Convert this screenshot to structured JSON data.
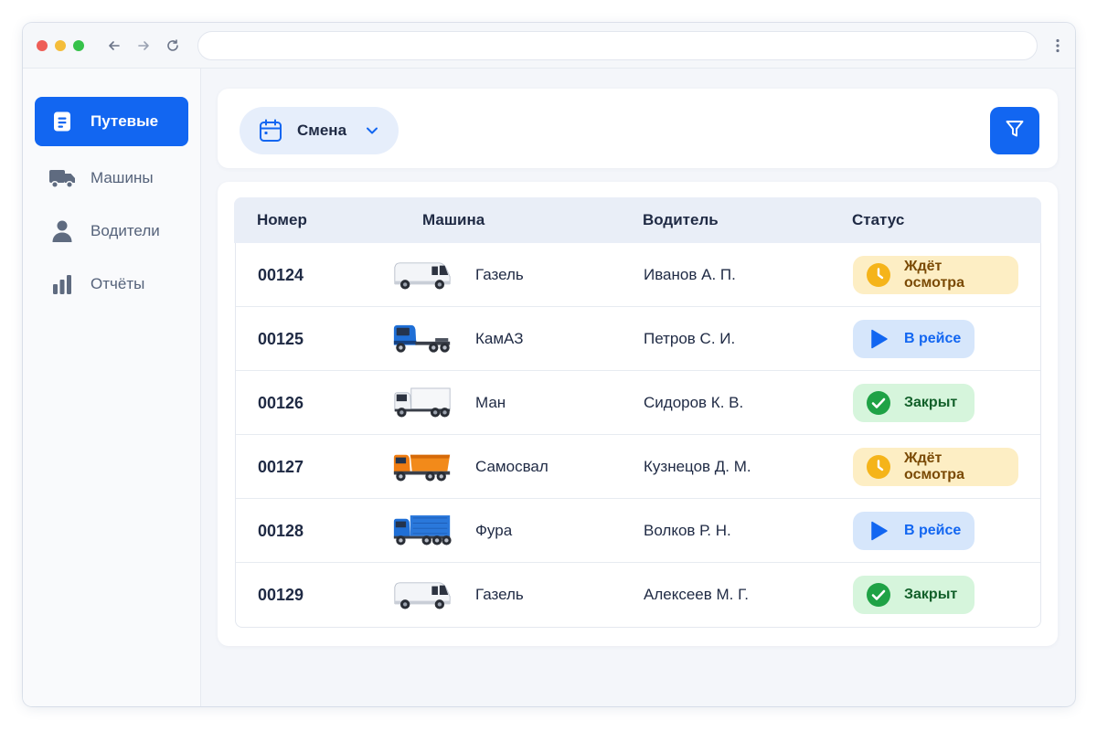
{
  "sidebar": {
    "items": [
      {
        "label": "Путевые",
        "icon": "document-icon",
        "active": true
      },
      {
        "label": "Машины",
        "icon": "truck-icon",
        "active": false
      },
      {
        "label": "Водители",
        "icon": "user-icon",
        "active": false
      },
      {
        "label": "Отчёты",
        "icon": "bar-chart-icon",
        "active": false
      }
    ]
  },
  "toolbar": {
    "shift_label": "Смена",
    "shift_icon": "calendar-icon",
    "filter_icon": "filter-icon"
  },
  "table": {
    "headers": [
      "Номер",
      "Машина",
      "Водитель",
      "Статус"
    ],
    "rows": [
      {
        "number": "00124",
        "vehicle": "Газель",
        "vehicle_icon": "white-van",
        "driver": "Иванов А. П.",
        "status": "Ждёт осмотра",
        "status_type": "waiting"
      },
      {
        "number": "00125",
        "vehicle": "КамАЗ",
        "vehicle_icon": "blue-tractor-truck",
        "driver": "Петров С. И.",
        "status": "В рейсе",
        "status_type": "trip"
      },
      {
        "number": "00126",
        "vehicle": "Ман",
        "vehicle_icon": "white-box-truck",
        "driver": "Сидоров К. В.",
        "status": "Закрыт",
        "status_type": "closed"
      },
      {
        "number": "00127",
        "vehicle": "Самосвал",
        "vehicle_icon": "orange-dump-truck",
        "driver": "Кузнецов Д. М.",
        "status": "Ждёт осмотра",
        "status_type": "waiting"
      },
      {
        "number": "00128",
        "vehicle": "Фура",
        "vehicle_icon": "blue-cargo-truck",
        "driver": "Волков Р. Н.",
        "status": "В рейсе",
        "status_type": "trip"
      },
      {
        "number": "00129",
        "vehicle": "Газель",
        "vehicle_icon": "white-van",
        "driver": "Алексеев М. Г.",
        "status": "Закрыт",
        "status_type": "closed"
      }
    ]
  },
  "colors": {
    "accent": "#1266f1",
    "waiting_bg": "#fdeec4",
    "waiting_icon": "#f5b41a",
    "trip_bg": "#d6e6fb",
    "closed_bg": "#d6f5dc",
    "closed_icon": "#1fa246"
  }
}
